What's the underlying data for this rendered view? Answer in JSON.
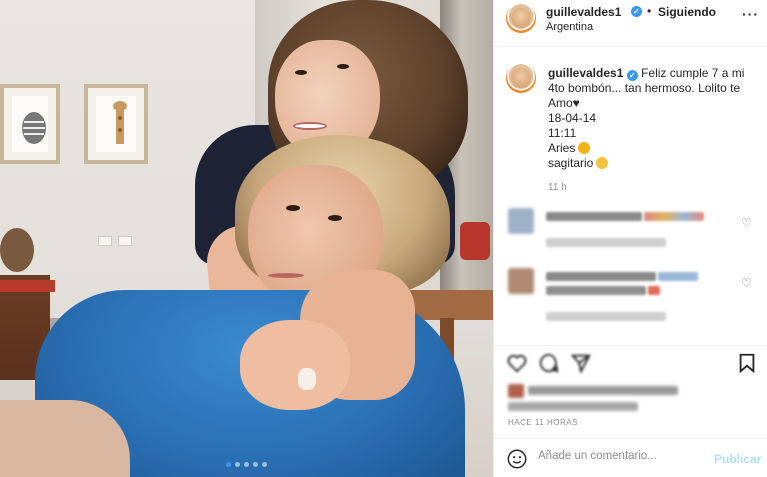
{
  "colors": {
    "accent": "#3897f0",
    "publish_disabled": "#b2dffc",
    "muted_text": "#8e8e8e",
    "divider": "#efefef"
  },
  "post": {
    "carousel": {
      "total": 5,
      "active": 0
    }
  },
  "header": {
    "username": "guillevaldes1",
    "separator": "•",
    "follow_status": "Siguiendo",
    "location": "Argentina",
    "more_icon": "more-options-icon"
  },
  "caption": {
    "username": "guillevaldes1",
    "text": "Feliz cumple 7 a mi 4to bombón... tan hermoso. Lolito te Amo♥",
    "line_date": "18-04-14",
    "line_time": "11:11",
    "line_aries": "Aries",
    "line_sagitario": "sagitario",
    "age": "11 h"
  },
  "actions": {
    "icons": [
      "like-icon",
      "comment-icon",
      "share-icon",
      "bookmark-icon"
    ]
  },
  "timestamp": "HACE 11 HORAS",
  "comment_box": {
    "placeholder": "Añade un comentario...",
    "publish_label": "Publicar",
    "emoji_icon": "emoji-icon"
  }
}
